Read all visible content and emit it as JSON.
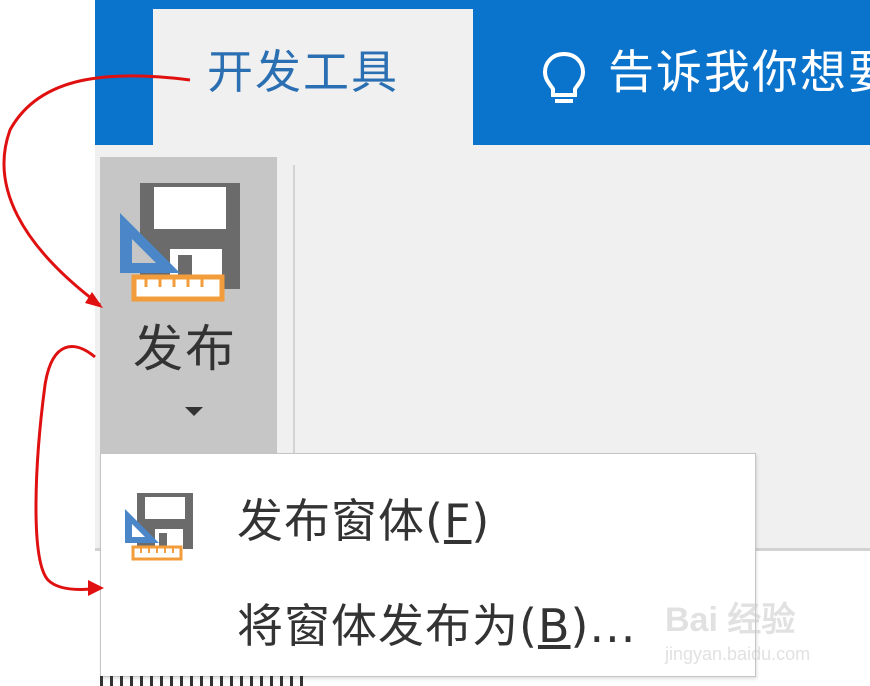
{
  "ribbon": {
    "active_tab": "开发工具",
    "tell_me": "告诉我你想要做什么"
  },
  "group": {
    "publish_label": "发布",
    "publish_icon": "publish-form-icon"
  },
  "menu": {
    "items": [
      {
        "prefix": "发布窗体(",
        "key": "F",
        "suffix": ")",
        "icon": "publish-form-icon"
      },
      {
        "prefix": "将窗体发布为(",
        "key": "B",
        "suffix": ")...",
        "icon": ""
      }
    ]
  },
  "watermark": {
    "main": "Bai 经验",
    "sub": "jingyan.baidu.com"
  },
  "colors": {
    "ribbon_blue": "#0a73cc",
    "annotation_red": "#e01010",
    "icon_orange": "#f39c3b",
    "icon_blue": "#4a86c8"
  }
}
